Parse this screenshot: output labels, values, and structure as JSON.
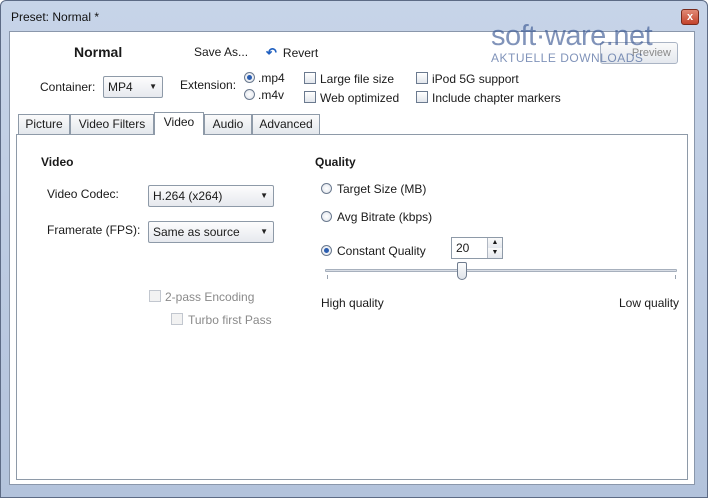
{
  "window": {
    "title": "Preset: Normal *",
    "close_glyph": "x"
  },
  "toolbar": {
    "preset_name": "Normal",
    "save_as_label": "Save As...",
    "revert_label": "Revert",
    "preview_label": "Preview"
  },
  "watermark": {
    "main": "soft·ware.net",
    "sub": "AKTUELLE DOWNLOADS"
  },
  "container": {
    "label": "Container:",
    "value": "MP4"
  },
  "extension": {
    "label": "Extension:",
    "options": [
      {
        "label": ".mp4",
        "selected": true
      },
      {
        "label": ".m4v",
        "selected": false
      }
    ]
  },
  "options": {
    "large_file_size": "Large file size",
    "web_optimized": "Web optimized",
    "ipod_5g": "iPod 5G support",
    "chapter_markers": "Include chapter markers"
  },
  "tabs": [
    {
      "label": "Picture"
    },
    {
      "label": "Video Filters"
    },
    {
      "label": "Video",
      "active": true
    },
    {
      "label": "Audio"
    },
    {
      "label": "Advanced"
    }
  ],
  "video": {
    "section_title": "Video",
    "codec_label": "Video Codec:",
    "codec_value": "H.264 (x264)",
    "framerate_label": "Framerate (FPS):",
    "framerate_value": "Same as source",
    "two_pass_label": "2-pass Encoding",
    "turbo_label": "Turbo first Pass"
  },
  "quality": {
    "section_title": "Quality",
    "target_size_label": "Target Size (MB)",
    "avg_bitrate_label": "Avg Bitrate (kbps)",
    "constant_quality_label": "Constant Quality",
    "constant_quality_value": "20",
    "slider_position": 0.39,
    "high_label": "High quality",
    "low_label": "Low quality"
  },
  "colors": {
    "accent": "#2a5db0",
    "frame": "#b3c3dc"
  }
}
